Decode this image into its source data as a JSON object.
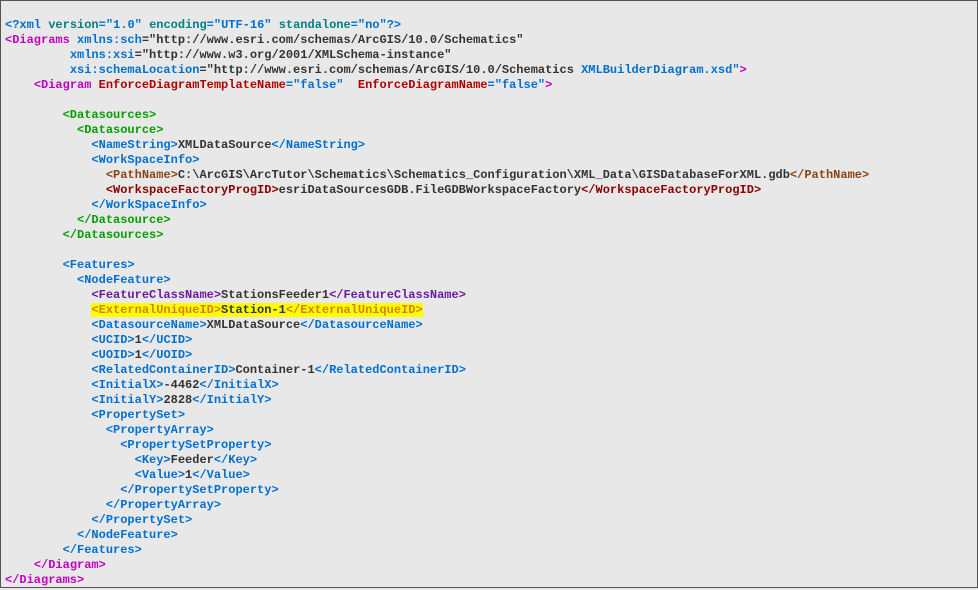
{
  "xmlDecl": {
    "open": "<?xml ",
    "ver_attr": "version",
    "ver_val": "\"1.0\"",
    "enc_attr": "encoding",
    "enc_val": "\"UTF-16\"",
    "sa_attr": "standalone",
    "sa_val": "\"no\"",
    "close": "?>"
  },
  "diagrams": {
    "open": "<Diagrams ",
    "ns1_attr": "xmlns:sch",
    "ns1_val": "\"http://www.esri.com/schemas/ArcGIS/10.0/Schematics\"",
    "ns2_attr": "xmlns:xsi",
    "ns2_val": "\"http://www.w3.org/2001/XMLSchema-instance\"",
    "ns3_attr": "xsi:schemaLocation",
    "ns3_val_a": "\"http://www.esri.com/schemas/ArcGIS/10.0/Schematics ",
    "ns3_val_b": "XMLBuilderDiagram.xsd\"",
    "gt": ">",
    "close": "</Diagrams>"
  },
  "diagram": {
    "open": "<Diagram ",
    "a1": "EnforceDiagramTemplateName",
    "v1": "\"false\"",
    "a2": "EnforceDiagramName",
    "v2": "\"false\"",
    "gt": ">",
    "close": "</Diagram>"
  },
  "ds": {
    "sources_o": "<Datasources>",
    "sources_c": "</Datasources>",
    "source_o": "<Datasource>",
    "source_c": "</Datasource>",
    "namestr_o": "<NameString>",
    "namestr_t": "XMLDataSource",
    "namestr_c": "</NameString>",
    "wsi_o": "<WorkSpaceInfo>",
    "wsi_c": "</WorkSpaceInfo>",
    "path_o": "<PathName>",
    "path_t": "C:\\ArcGIS\\ArcTutor\\Schematics\\Schematics_Configuration\\XML_Data\\GISDatabaseForXML.gdb",
    "path_c": "</PathName>",
    "wfp_o": "<WorkspaceFactoryProgID>",
    "wfp_t": "esriDataSourcesGDB.FileGDBWorkspaceFactory",
    "wfp_c": "</WorkspaceFactoryProgID>"
  },
  "feat": {
    "features_o": "<Features>",
    "features_c": "</Features>",
    "nf_o": "<NodeFeature>",
    "nf_c": "</NodeFeature>",
    "fcn_o": "<FeatureClassName>",
    "fcn_t": "StationsFeeder1",
    "fcn_c": "</FeatureClassName>",
    "euid_o": "<ExternalUniqueID>",
    "euid_t": "Station-1",
    "euid_c": "</ExternalUniqueID>",
    "dsn_o": "<DatasourceName>",
    "dsn_t": "XMLDataSource",
    "dsn_c": "</DatasourceName>",
    "ucid_o": "<UCID>",
    "ucid_t": "1",
    "ucid_c": "</UCID>",
    "uoid_o": "<UOID>",
    "uoid_t": "1",
    "uoid_c": "</UOID>",
    "rcid_o": "<RelatedContainerID>",
    "rcid_t": "Container-1",
    "rcid_c": "</RelatedContainerID>",
    "ix_o": "<InitialX>",
    "ix_t": "-4462",
    "ix_c": "</InitialX>",
    "iy_o": "<InitialY>",
    "iy_t": "2828",
    "iy_c": "</InitialY>",
    "ps_o": "<PropertySet>",
    "ps_c": "</PropertySet>",
    "pa_o": "<PropertyArray>",
    "pa_c": "</PropertyArray>",
    "psp_o": "<PropertySetProperty>",
    "psp_c": "</PropertySetProperty>",
    "key_o": "<Key>",
    "key_t": "Feeder",
    "key_c": "</Key>",
    "val_o": "<Value>",
    "val_t": "1",
    "val_c": "</Value>"
  },
  "ind": {
    "i1": "    ",
    "i2": "        ",
    "i21": "         ",
    "i3": "          ",
    "i4": "            ",
    "i5": "              ",
    "i6": "                ",
    "i61": "                 "
  }
}
